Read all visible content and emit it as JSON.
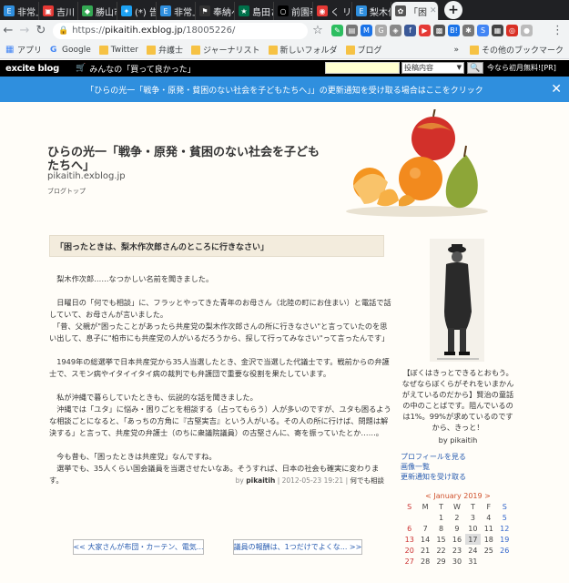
{
  "tabs": [
    {
      "label": "非常上",
      "color": "#2f8fde",
      "glyph": "E"
    },
    {
      "label": "吉川 泰",
      "color": "#e53935",
      "glyph": "▣"
    },
    {
      "label": "勝山市",
      "color": "#34a853",
      "glyph": "◆"
    },
    {
      "label": "(*) 告発",
      "color": "#1da1f2",
      "glyph": "✦"
    },
    {
      "label": "非常上",
      "color": "#2f8fde",
      "glyph": "E"
    },
    {
      "label": "奉納へ",
      "color": "#333333",
      "glyph": "⚑"
    },
    {
      "label": "島田さ",
      "color": "#00704a",
      "glyph": "★"
    },
    {
      "label": "前園泰",
      "color": "#000000",
      "glyph": "○"
    },
    {
      "label": "く リ",
      "color": "#e53935",
      "glyph": "◉"
    },
    {
      "label": "梨木作",
      "color": "#2f8fde",
      "glyph": "E"
    },
    {
      "label": "「困",
      "color": "#555555",
      "glyph": "✿",
      "active": true
    }
  ],
  "browser": {
    "new_tab": "+",
    "window_controls": "—  ▢  ✕",
    "url_scheme": "https://",
    "url_host": "pikaitih.exblog.jp",
    "url_path": "/18005226/",
    "back": "←",
    "forward": "→",
    "reload": "↻",
    "star": "☆",
    "menu": "⋮"
  },
  "extensions": [
    {
      "name": "evernote-icon",
      "color": "#2dbe60",
      "glyph": "✎"
    },
    {
      "name": "gray-icon",
      "color": "#777777",
      "glyph": "▤"
    },
    {
      "name": "bookmark-icon",
      "color": "#1a73e8",
      "glyph": "M"
    },
    {
      "name": "g-icon",
      "color": "#aaaaaa",
      "glyph": "G"
    },
    {
      "name": "pocket-icon",
      "color": "#888888",
      "glyph": "◈"
    },
    {
      "name": "fb-icon",
      "color": "#3b5998",
      "glyph": "f"
    },
    {
      "name": "play-icon",
      "color": "#e53935",
      "glyph": "▶"
    },
    {
      "name": "ext-icon",
      "color": "#555555",
      "glyph": "▩"
    },
    {
      "name": "hatena-icon",
      "color": "#1a73e8",
      "glyph": "B!"
    },
    {
      "name": "gear-ext-icon",
      "color": "#777777",
      "glyph": "✱"
    },
    {
      "name": "sync-icon",
      "color": "#4285f4",
      "glyph": "S"
    },
    {
      "name": "d-icon",
      "color": "#444444",
      "glyph": "▦"
    },
    {
      "name": "circle-icon",
      "color": "#d93025",
      "glyph": "◎"
    },
    {
      "name": "avatar-icon",
      "color": "#bbbbbb",
      "glyph": "●"
    }
  ],
  "bookmarks": [
    {
      "label": "アプリ",
      "type": "apps"
    },
    {
      "label": "Google",
      "type": "google"
    },
    {
      "label": "Twitter",
      "type": "folder"
    },
    {
      "label": "弁護士",
      "type": "folder"
    },
    {
      "label": "ジャーナリスト",
      "type": "folder"
    },
    {
      "label": "新しいフォルダ",
      "type": "folder"
    },
    {
      "label": "ブログ",
      "type": "folder"
    }
  ],
  "bookmarks_more": "»",
  "bookmarks_other": "その他のブックマーク",
  "excite": {
    "logo_main": "excite",
    "logo_sub": " blog",
    "cart_label": "みんなの「買って良かった」",
    "search_select": "投稿内容",
    "search_button_icon": "🔍",
    "right_text": "今なら初月無料![PR]"
  },
  "notice": {
    "text": "「ひらの光一「戦争・原発・貧困のない社会を子どもたちへ」」の更新通知を受け取る場合はここをクリック",
    "close": "✕"
  },
  "blog": {
    "title": "ひらの光一「戦争・原発・貧困のない社会を子どもたちへ」",
    "url": "pikaitih.exblog.jp",
    "top_link": "ブログトップ"
  },
  "entry": {
    "title": "「困ったときは、梨木作次郎さんのところに行きなさい」",
    "paragraphs": [
      "梨木作次郎……なつかしい名前を聞きました。",
      "日曜日の「何でも相談」に、フラッとやってきた青年のお母さん（北陸の町にお住まい）と電話で話していて、お母さんが言いました。\n「昔、父親が\"困ったことがあったら共産党の梨木作次郎さんの所に行きなさい\"と言っていたのを思い出して、息子に\"柏市にも共産党の人がいるだろうから、探して行ってみなさい\"って言ったんです」",
      "1949年の総選挙で日本共産党から35人当選したとき、金沢で当選した代議士です。戦前からの弁護士で、スモン病やイタイイタイ病の裁判でも弁護団で重要な役割を果たしています。",
      "私が沖縄で暮らしていたときも、伝説的な話を聞きました。\n沖縄では「ユタ」に悩み・困りごとを相談する（占ってもらう）人が多いのですが、ユタも困るような相談ごとになると、「あっちの方角に『古堅実吉』という人がいる。その人の所に行けば、問題は解決する」と言って、共産党の弁護士（のちに衆議院議員）の古堅さんに、寄を振っていたとか……。",
      "今も昔も、「困ったときは共産党」なんですね。\n選挙でも、35人くらい国会議員を当選させたいなあ。そうすれば、日本の社会も確実に変わります。"
    ],
    "meta_by": "by ",
    "meta_author": "pikaitih",
    "meta_date": " | 2012-05-23 19:21 | ",
    "meta_category": "何でも相談"
  },
  "pager": {
    "prev": "<< 大家さんが布団・カーテン、電気...",
    "next": "議員の報酬は、1つだけでよくな... >>"
  },
  "sidebar": {
    "quote": "【ぼくはきっとできるとおもう。なぜならぼくらがそれをいまかんがえているのだから】賢治の童話の中のことばです。阻んでいるのは1%。99%が求めているのですから、きっと！",
    "by_author": "by pikaitih",
    "links": [
      "プロフィールを見る",
      "画像一覧",
      "更新通知を受け取る"
    ],
    "calendar_title": "< January 2019 >",
    "weekdays": [
      "S",
      "M",
      "T",
      "W",
      "T",
      "F",
      "S"
    ],
    "weeks": [
      [
        "",
        "",
        "1",
        "2",
        "3",
        "4",
        "5"
      ],
      [
        "6",
        "7",
        "8",
        "9",
        "10",
        "11",
        "12"
      ],
      [
        "13",
        "14",
        "15",
        "16",
        "17",
        "18",
        "19"
      ],
      [
        "20",
        "21",
        "22",
        "23",
        "24",
        "25",
        "26"
      ],
      [
        "27",
        "28",
        "29",
        "30",
        "31",
        "",
        ""
      ]
    ],
    "today": "17"
  }
}
